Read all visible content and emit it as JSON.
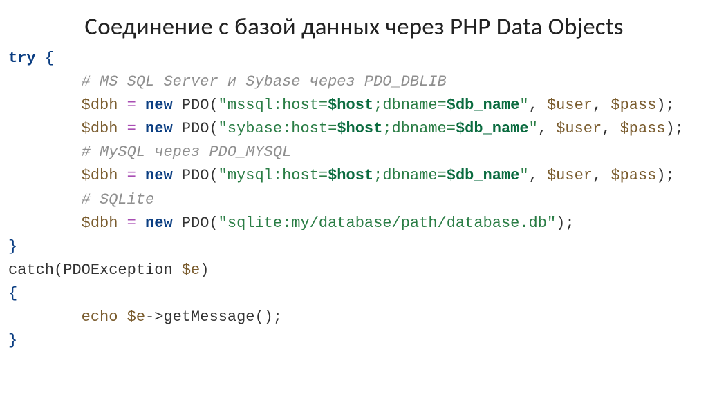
{
  "title": "Соединение с базой данных через PHP Data Objects",
  "code": {
    "l1_try": "try",
    "l1_brace": " {",
    "indent": "        ",
    "l2_comment": "# MS SQL Server и Sybase через PDO_DBLIB",
    "assign_var": "$dbh",
    "assign_eq": " = ",
    "new_kw": "new",
    "pdo_fn": " PDO(",
    "close_call": ");",
    "l3_str_a": "\"mssql:host=",
    "l3_str_b": ";dbname=",
    "l3_str_c": "\"",
    "host_var": "$host",
    "db_var": "$db_name",
    "sep": ", ",
    "user_var": "$user",
    "pass_var": "$pass",
    "l4_str_a": "\"sybase:host=",
    "l5_comment": "# MySQL через PDO_MYSQL",
    "l6_str_a": "\"mysql:host=",
    "l7_comment": "# SQLite",
    "l8_str": "\"sqlite:my/database/path/database.db\"",
    "l9_brace": "}",
    "catch_kw": "catch",
    "catch_open": "(",
    "exc_class": "PDOException ",
    "e_var": "$e",
    "catch_close": ")",
    "l11_brace": "{",
    "echo_kw": "echo ",
    "arrow": "->",
    "getmsg": "getMessage",
    "getmsg_call": "();",
    "l13_brace": "}"
  }
}
